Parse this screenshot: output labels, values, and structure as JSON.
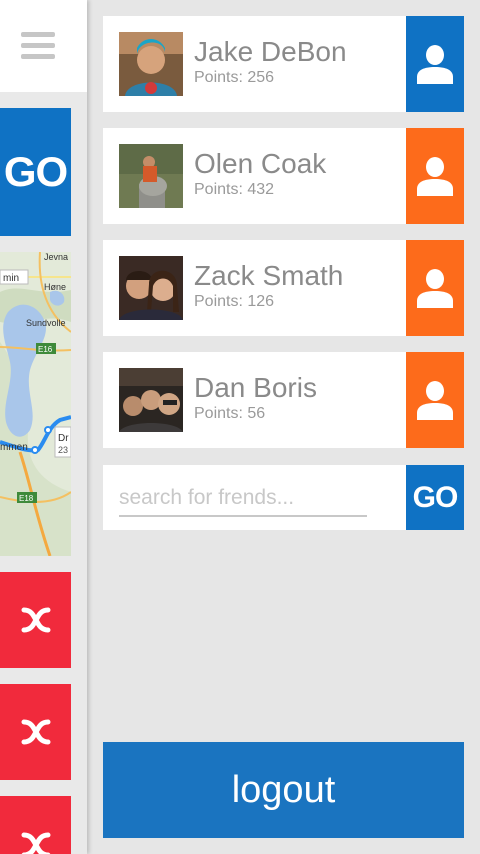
{
  "sidebar": {
    "go_label": "GO",
    "map": {
      "labels": [
        "min",
        "Jevna",
        "Høne",
        "Sundvolle",
        "E16",
        "Dr",
        "23",
        "mmen",
        "E18"
      ]
    }
  },
  "friends": [
    {
      "name": "Jake DeBon",
      "points": "Points: 256",
      "action_color": "#0f72c4"
    },
    {
      "name": "Olen Coak",
      "points": "Points: 432",
      "action_color": "#fd6b1b"
    },
    {
      "name": "Zack Smath",
      "points": "Points: 126",
      "action_color": "#fd6b1b"
    },
    {
      "name": "Dan Boris",
      "points": "Points: 56",
      "action_color": "#fd6b1b"
    }
  ],
  "search": {
    "placeholder": "search for frends...",
    "go_label": "GO"
  },
  "logout_label": "logout",
  "colors": {
    "blue": "#0f72c4",
    "orange": "#fd6b1b",
    "red": "#f12a3c"
  }
}
